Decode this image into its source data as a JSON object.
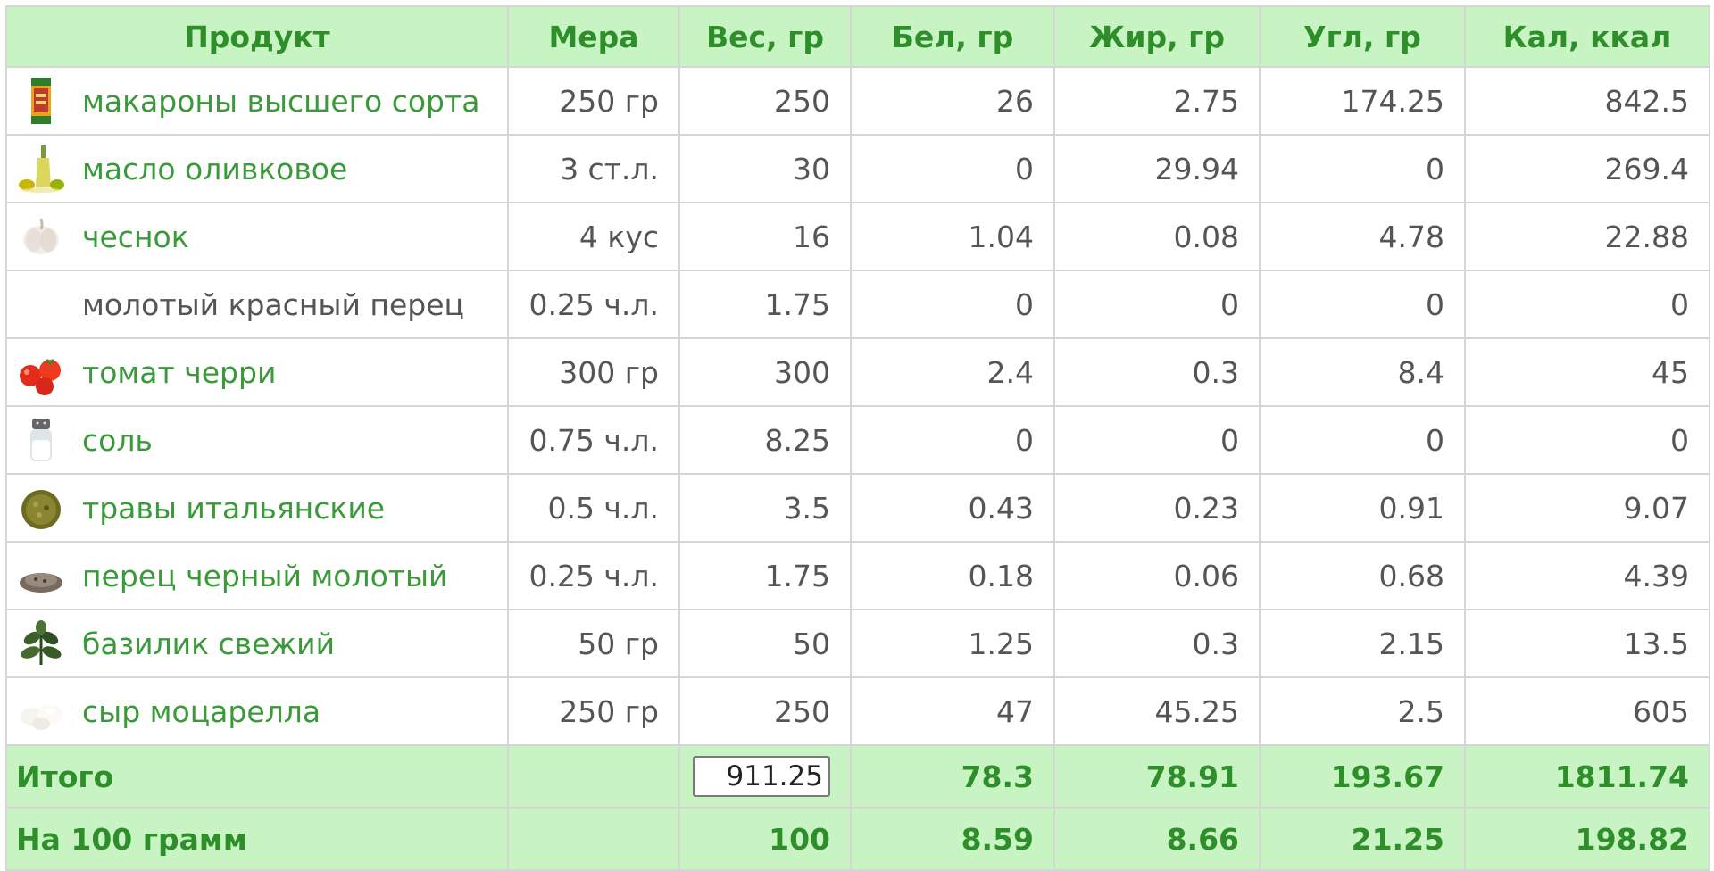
{
  "headers": {
    "product": "Продукт",
    "measure": "Мера",
    "weight": "Вес, гр",
    "protein": "Бел, гр",
    "fat": "Жир, гр",
    "carbs": "Угл, гр",
    "calories": "Кал, ккал"
  },
  "rows": [
    {
      "icon": "pasta-pack-icon",
      "name": "макароны высшего сорта",
      "link": true,
      "measure": "250 гр",
      "weight": "250",
      "protein": "26",
      "fat": "2.75",
      "carbs": "174.25",
      "calories": "842.5"
    },
    {
      "icon": "olive-oil-icon",
      "name": "масло оливковое",
      "link": true,
      "measure": "3 ст.л.",
      "weight": "30",
      "protein": "0",
      "fat": "29.94",
      "carbs": "0",
      "calories": "269.4"
    },
    {
      "icon": "garlic-icon",
      "name": "чеснок",
      "link": true,
      "measure": "4 кус",
      "weight": "16",
      "protein": "1.04",
      "fat": "0.08",
      "carbs": "4.78",
      "calories": "22.88"
    },
    {
      "icon": "",
      "name": "молотый красный перец",
      "link": false,
      "measure": "0.25 ч.л.",
      "weight": "1.75",
      "protein": "0",
      "fat": "0",
      "carbs": "0",
      "calories": "0"
    },
    {
      "icon": "cherry-tomato-icon",
      "name": "томат черри",
      "link": true,
      "measure": "300 гр",
      "weight": "300",
      "protein": "2.4",
      "fat": "0.3",
      "carbs": "8.4",
      "calories": "45"
    },
    {
      "icon": "salt-shaker-icon",
      "name": "соль",
      "link": true,
      "measure": "0.75 ч.л.",
      "weight": "8.25",
      "protein": "0",
      "fat": "0",
      "carbs": "0",
      "calories": "0"
    },
    {
      "icon": "italian-herbs-icon",
      "name": "травы итальянские",
      "link": true,
      "measure": "0.5 ч.л.",
      "weight": "3.5",
      "protein": "0.43",
      "fat": "0.23",
      "carbs": "0.91",
      "calories": "9.07"
    },
    {
      "icon": "ground-pepper-icon",
      "name": "перец черный молотый",
      "link": true,
      "measure": "0.25 ч.л.",
      "weight": "1.75",
      "protein": "0.18",
      "fat": "0.06",
      "carbs": "0.68",
      "calories": "4.39"
    },
    {
      "icon": "basil-icon",
      "name": "базилик свежий",
      "link": true,
      "measure": "50 гр",
      "weight": "50",
      "protein": "1.25",
      "fat": "0.3",
      "carbs": "2.15",
      "calories": "13.5"
    },
    {
      "icon": "mozzarella-icon",
      "name": "сыр моцарелла",
      "link": true,
      "measure": "250 гр",
      "weight": "250",
      "protein": "47",
      "fat": "45.25",
      "carbs": "2.5",
      "calories": "605"
    }
  ],
  "totals": {
    "label": "Итого",
    "weight_value": "911.25",
    "protein": "78.3",
    "fat": "78.91",
    "carbs": "193.67",
    "calories": "1811.74"
  },
  "per100": {
    "label": "На 100 грамм",
    "weight": "100",
    "protein": "8.59",
    "fat": "8.66",
    "carbs": "21.25",
    "calories": "198.82"
  },
  "colors": {
    "header_bg": "#c8f4c4",
    "header_text": "#2e8f2a",
    "link_text": "#3a9a3a",
    "border": "#d6d6d6"
  }
}
